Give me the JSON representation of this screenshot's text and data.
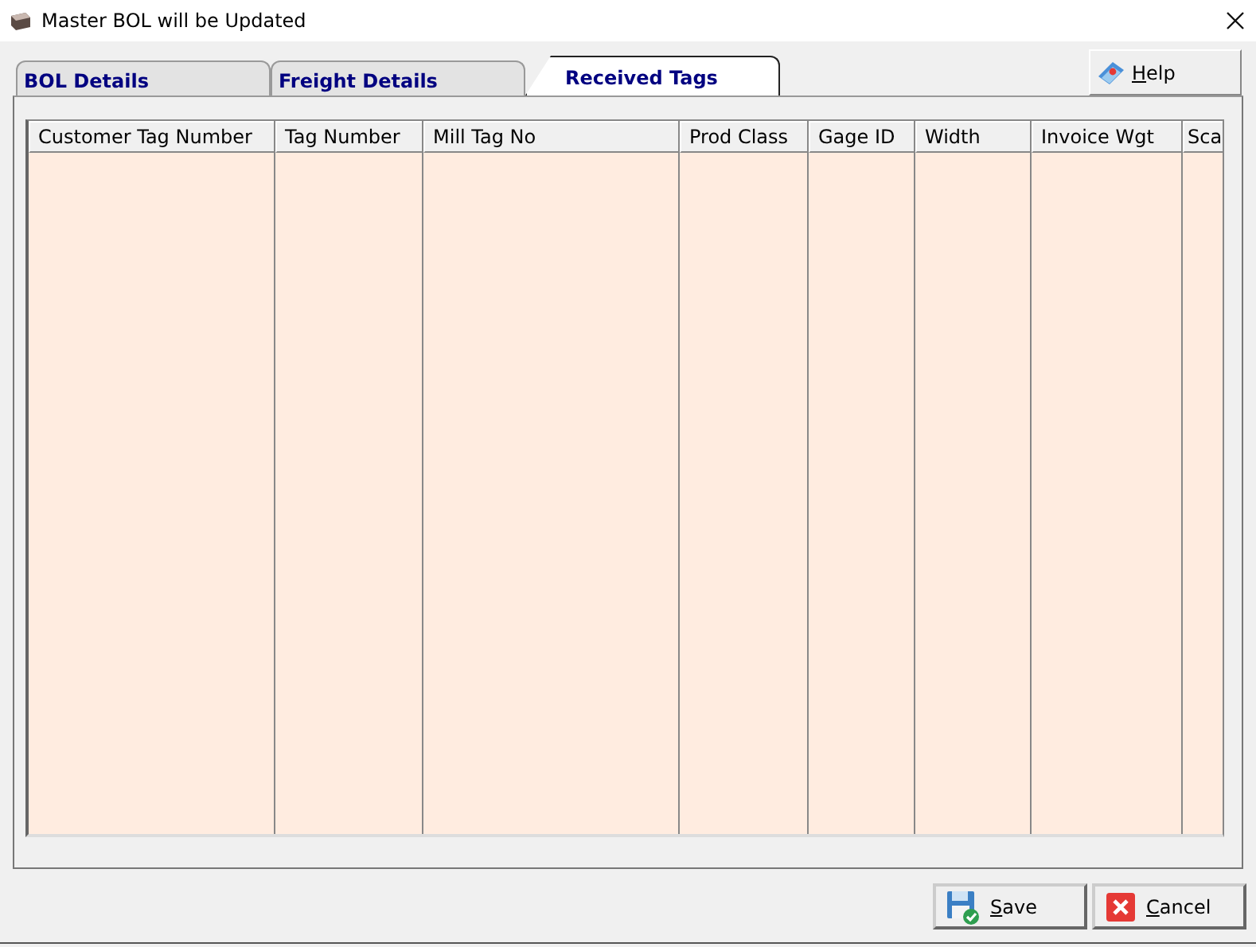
{
  "window": {
    "title": "Master BOL will be Updated"
  },
  "tabs": [
    {
      "label": "BOL Details",
      "selected": false
    },
    {
      "label": "Freight Details",
      "selected": false
    },
    {
      "label": "Received Tags",
      "selected": true
    }
  ],
  "help_button": {
    "label": "Help",
    "mnemonic": true
  },
  "table": {
    "columns": [
      "Customer Tag Number",
      "Tag Number",
      "Mill Tag No",
      "Prod Class",
      "Gage ID",
      "Width",
      "Invoice Wgt",
      "Sca"
    ]
  },
  "buttons": [
    {
      "kind": "save",
      "label": "Save",
      "mnemonic": true
    },
    {
      "kind": "cancel",
      "label": "Cancel",
      "mnemonic": true
    }
  ]
}
